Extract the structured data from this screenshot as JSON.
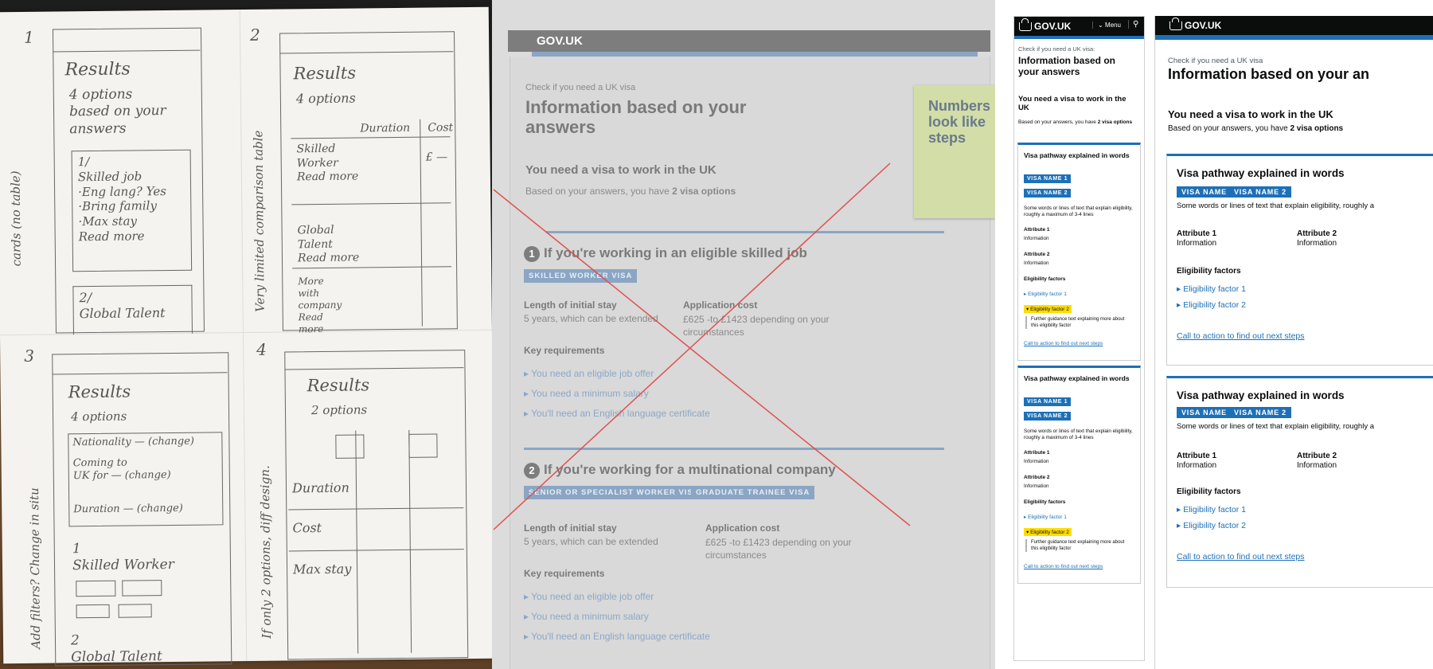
{
  "sketch": {
    "frame1": {
      "num": "1",
      "title": "Results",
      "sub": "4 options\nbased on your\nanswers",
      "card": "1/\nSkilled job\n·Eng lang? Yes\n·Bring family\n·Max stay\nRead more",
      "card2": "2/\nGlobal Talent",
      "side": "cards (no table)"
    },
    "frame2": {
      "num": "2",
      "title": "Results",
      "sub": "4 options",
      "col1": "Duration",
      "col2": "Cost",
      "r1": "Skilled\nWorker\nRead more",
      "r2": "Global\nTalent\nRead more",
      "r3": "More\nwith\ncompany\nRead\nmore",
      "pound": "£ —",
      "side": "Very limited comparison table"
    },
    "frame3": {
      "num": "3",
      "title": "Results",
      "sub": "4 options",
      "f1": "Nationality — (change)",
      "f2": "Coming to\nUK for — (change)",
      "f3": "Duration — (change)",
      "r1": "1\nSkilled Worker",
      "r2": "2\nGlobal Talent",
      "side": "Add filters? Change in situ"
    },
    "frame4": {
      "num": "4",
      "title": "Results",
      "sub": "2 options",
      "rows": [
        "Duration",
        "Cost",
        "Max stay"
      ],
      "side": "If only 2 options, diff design."
    }
  },
  "grey_mock": {
    "header": "GOV.UK",
    "caption": "Check if you need a UK visa",
    "title": "Information based on your answers",
    "subtitle": "You need a visa to work in the UK",
    "summary_prefix": "Based on your answers, you have ",
    "summary_bold": "2 visa options",
    "options": [
      {
        "num": "1",
        "title": "If you're working in an eligible skilled job",
        "tags": [
          "SKILLED WORKER VISA"
        ],
        "stay_label": "Length of initial stay",
        "stay": "5 years, which can be extended",
        "cost_label": "Application cost",
        "cost": "£625 -to £1423 depending on your circumstances",
        "req_label": "Key requirements",
        "reqs": [
          "You need an eligible job offer",
          "You need a minimum salary",
          "You'll need an English language certificate"
        ]
      },
      {
        "num": "2",
        "title": "If you're working for a multinational company",
        "tags": [
          "SENIOR OR SPECIALIST WORKER VISA",
          "GRADUATE TRAINEE VISA"
        ],
        "stay_label": "Length of initial stay",
        "stay": "5 years, which can be extended",
        "cost_label": "Application cost",
        "cost": "£625 -to £1423 depending on your circumstances",
        "req_label": "Key requirements",
        "reqs": [
          "You need an eligible job offer",
          "You need a minimum salary",
          "You'll need an English language certificate"
        ]
      }
    ],
    "sticky_note": "Numbers look like steps"
  },
  "mobile_mock": {
    "logo": "GOV.UK",
    "menu": "Menu",
    "caption": "Check if you need a UK visa:",
    "title": "Information based on your answers",
    "subtitle": "You need a visa to work in the UK",
    "summary_prefix": "Based on your answers, you have ",
    "summary_bold": "2 visa options",
    "card": {
      "title": "Visa pathway explained in words",
      "tag1": "VISA NAME 1",
      "tag2": "VISA NAME 2",
      "desc": "Some words or lines of text that explain eligibility, roughly a maximum of 3-4 lines",
      "a1": "Attribute 1",
      "i1": "Information",
      "a2": "Attribute 2",
      "i2": "Information",
      "elig": "Eligibility factors",
      "f1": "Eligibility factor 1",
      "f2": "Eligibility factor 2",
      "guide": "Further guidance text explaining more about this eligibility factor",
      "cta": "Call to action to find out next steps"
    }
  },
  "desktop_mock": {
    "logo": "GOV.UK",
    "caption": "Check if you need a UK visa",
    "title": "Information based on your an",
    "subtitle": "You need a visa to work in the UK",
    "summary_prefix": "Based on your answers, you have ",
    "summary_bold": "2 visa options",
    "card": {
      "title": "Visa pathway explained in words",
      "tag1": "VISA NAME 1",
      "tag2": "VISA NAME 2",
      "desc": "Some words or lines of text that explain eligibility, roughly a",
      "a1": "Attribute 1",
      "i1": "Information",
      "a2": "Attribute 2",
      "i2": "Information",
      "elig": "Eligibility factors",
      "f1": "Eligibility factor 1",
      "f2": "Eligibility factor 2",
      "cta": "Call to action to find out next steps"
    }
  },
  "colors": {
    "govuk_blue": "#1d70b8",
    "govuk_black": "#0b0c0c",
    "yellow": "#ffdd00",
    "strike": "#e05050",
    "sticky": "#d3dda8"
  }
}
